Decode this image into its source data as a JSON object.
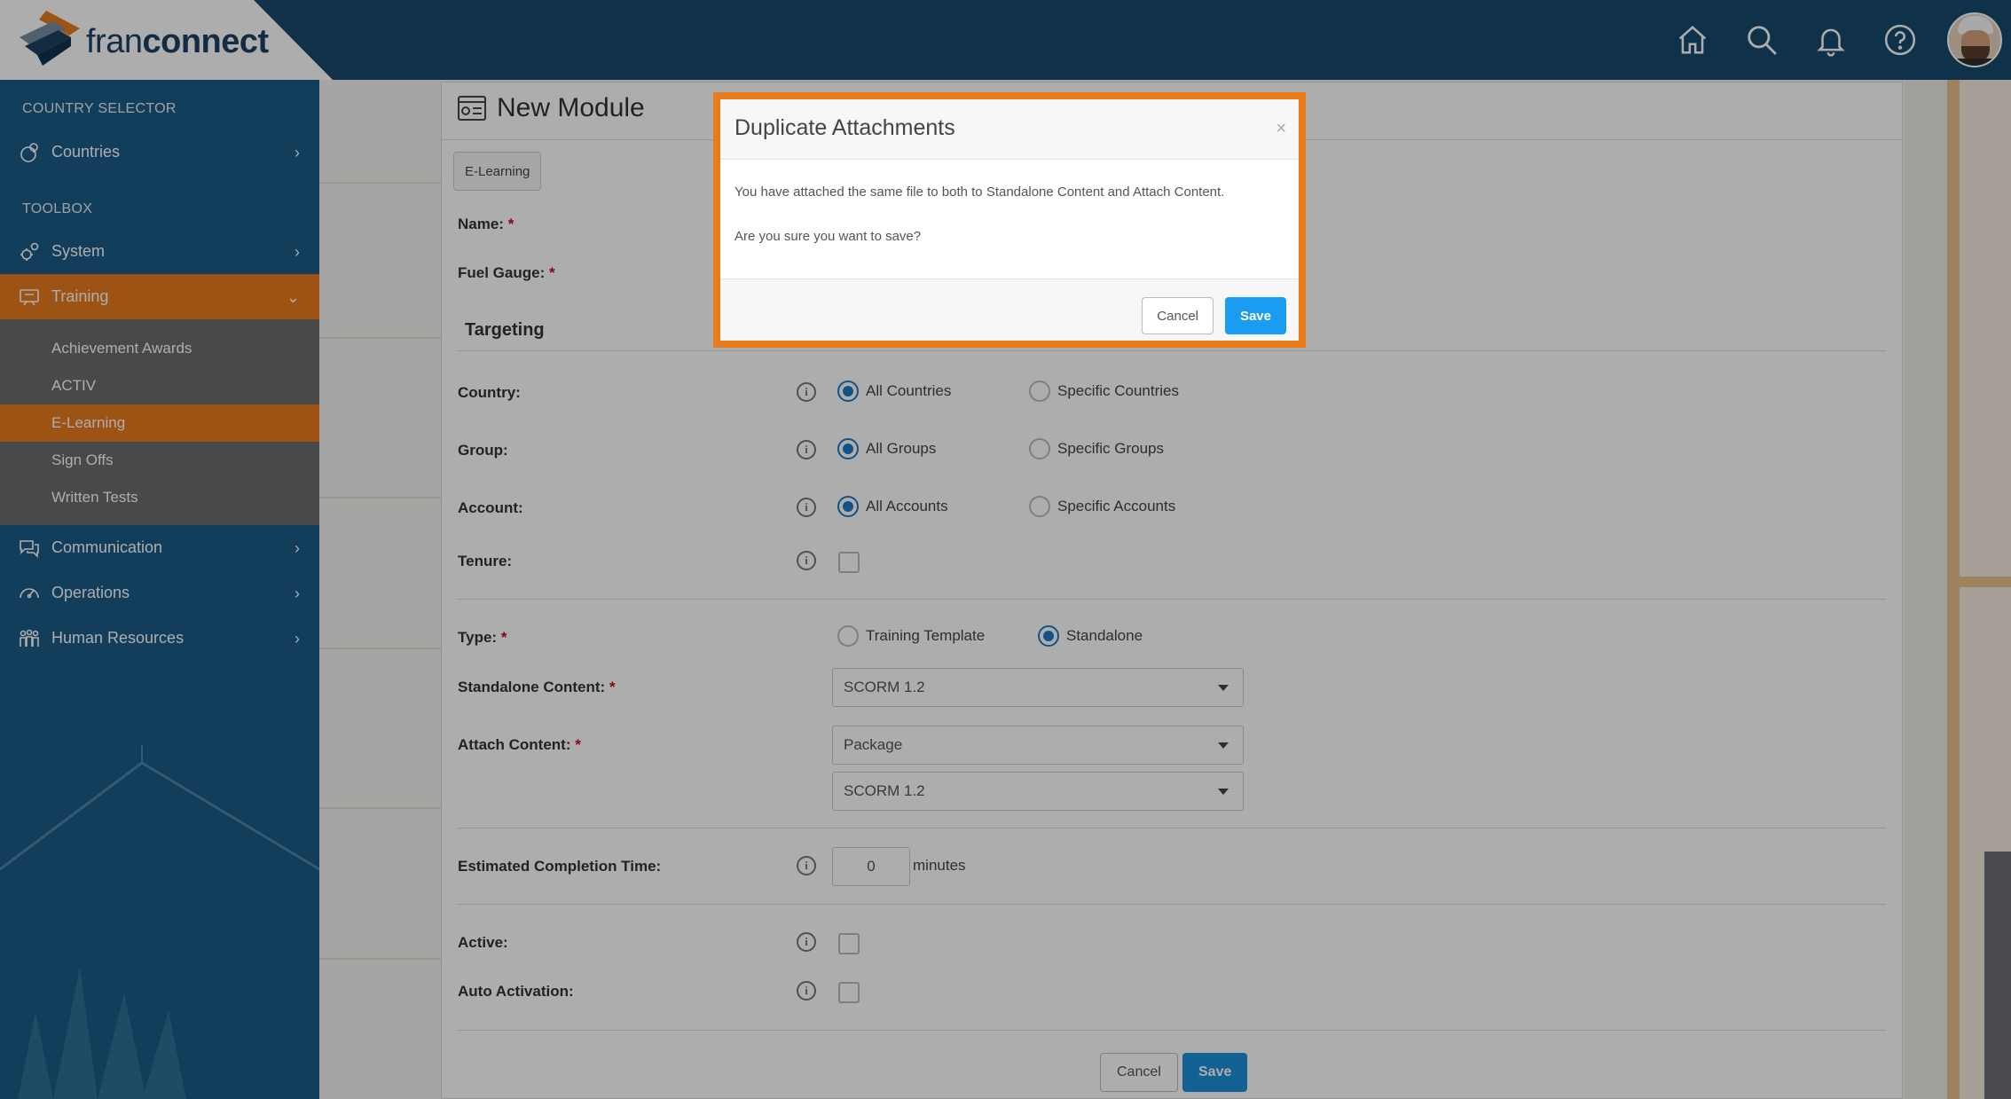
{
  "brand": {
    "name_light": "fran",
    "name_bold": "connect",
    "accent": "#e87b1c",
    "nav_bg": "#174a6e"
  },
  "topbar": {
    "icons": [
      "home-icon",
      "search-icon",
      "bell-icon",
      "help-icon"
    ]
  },
  "sidebar": {
    "heading_country": "COUNTRY SELECTOR",
    "countries": "Countries",
    "heading_toolbox": "TOOLBOX",
    "system": "System",
    "training": "Training",
    "training_sub": [
      "Achievement Awards",
      "ACTIV",
      "E-Learning",
      "Sign Offs",
      "Written Tests"
    ],
    "communication": "Communication",
    "operations": "Operations",
    "human_resources": "Human Resources"
  },
  "main": {
    "title": "New Module",
    "tag": "E-Learning",
    "name_label": "Name:",
    "fuel_label": "Fuel Gauge:",
    "targeting": "Targeting",
    "country_label": "Country:",
    "country_opt1": "All Countries",
    "country_opt2": "Specific Countries",
    "group_label": "Group:",
    "group_opt1": "All Groups",
    "group_opt2": "Specific Groups",
    "account_label": "Account:",
    "account_opt1": "All Accounts",
    "account_opt2": "Specific Accounts",
    "tenure_label": "Tenure:",
    "type_label": "Type:",
    "type_opt1": "Training Template",
    "type_opt2": "Standalone",
    "standalone_label": "Standalone Content:",
    "standalone_value": "SCORM 1.2",
    "attach_label": "Attach Content:",
    "attach_value1": "Package",
    "attach_value2": "SCORM 1.2",
    "ect_label": "Estimated Completion Time:",
    "ect_value": "0",
    "ect_unit": "minutes",
    "active_label": "Active:",
    "auto_label": "Auto Activation:",
    "cancel": "Cancel",
    "save": "Save"
  },
  "modal": {
    "title": "Duplicate Attachments",
    "close": "×",
    "message": "You have attached the same file to both to Standalone Content and Attach Content.",
    "question": "Are you sure you want to save?",
    "cancel": "Cancel",
    "save": "Save"
  }
}
